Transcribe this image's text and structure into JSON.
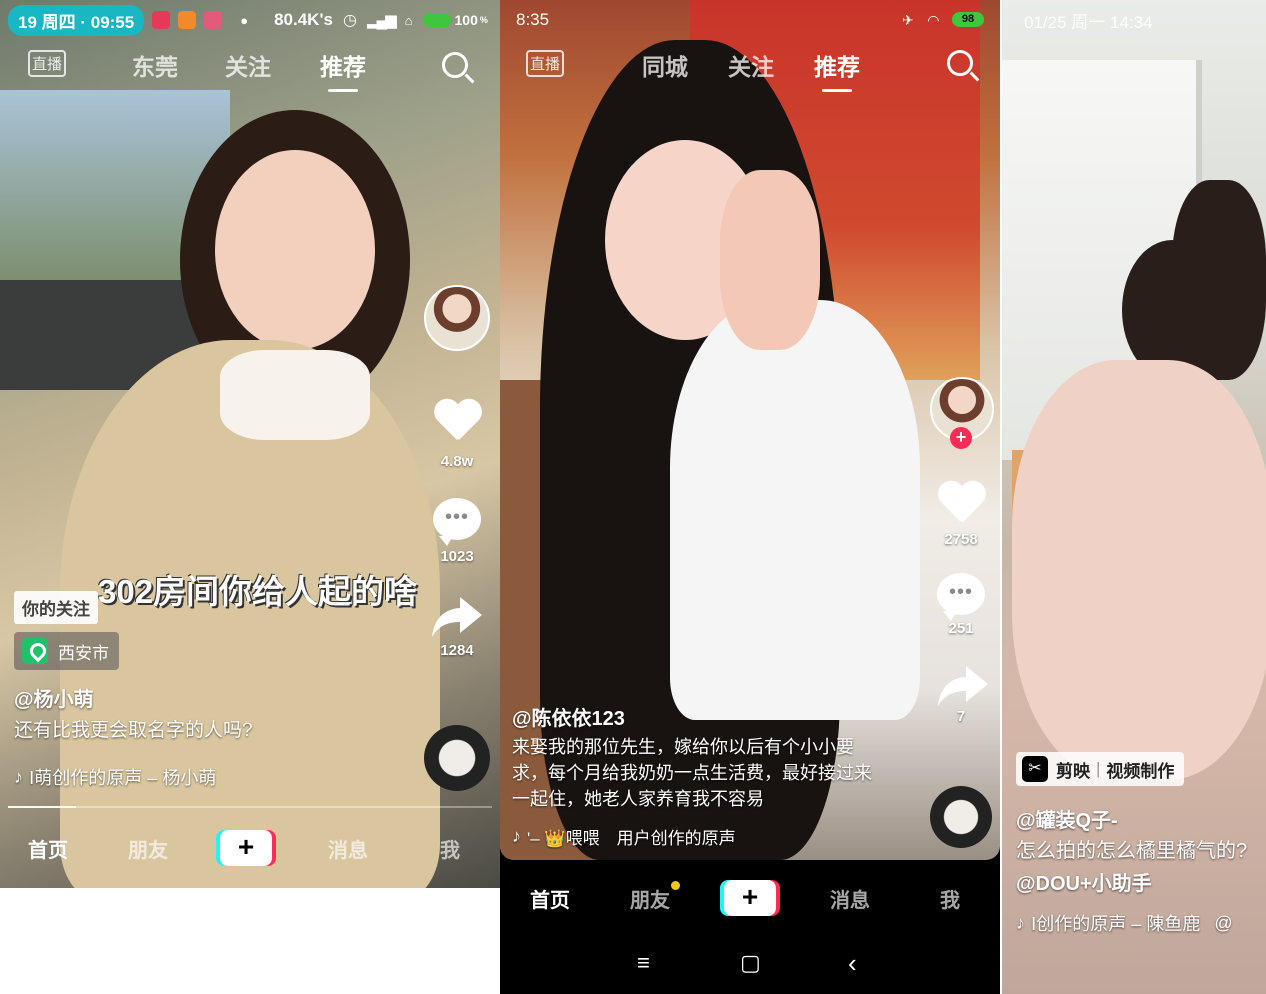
{
  "panel1": {
    "status": {
      "time": "19 周四 · 09:55",
      "net_speed": "80.4K's",
      "battery": "100",
      "battery_unit": "%"
    },
    "tabs": {
      "live": "直播",
      "items": [
        "东莞",
        "关注",
        "推荐"
      ],
      "active": "推荐"
    },
    "rail": {
      "likes": "4.8w",
      "comments": "1023",
      "shares": "1284"
    },
    "overlay_text": "302房间你给人起的啥",
    "tag": "你的关注",
    "location": "西安市",
    "author": "@杨小萌",
    "description": "还有比我更会取名字的人吗?",
    "music": "Ⅰ萌创作的原声 – 杨小萌",
    "progress": 0.14,
    "nav": {
      "home": "首页",
      "friends": "朋友",
      "plus": "+",
      "messages": "消息",
      "me": "我"
    },
    "icons": [
      "search-icon",
      "heart-icon",
      "comment-icon",
      "share-icon",
      "music-note-icon",
      "location-icon"
    ]
  },
  "panel2": {
    "status": {
      "time": "8:35",
      "battery": "98"
    },
    "tabs": {
      "live": "直播",
      "items": [
        "同城",
        "关注",
        "推荐"
      ],
      "active": "推荐"
    },
    "rail": {
      "likes": "2758",
      "comments": "251",
      "shares": "7",
      "follow": "+"
    },
    "author": "@陈依依123",
    "description": "来娶我的那位先生，嫁给你以后有个小小要求，每个月给我奶奶一点生活费，最好接过来一起住，她老人家养育我不容易",
    "music": "'– 👑喂喂　用户创作的原声",
    "nav": {
      "home": "首页",
      "friends": "朋友",
      "plus": "+",
      "messages": "消息",
      "me": "我"
    },
    "sysnav": {
      "menu": "≡",
      "home": "▢",
      "back": "‹"
    }
  },
  "panel3": {
    "status": {
      "time": "01/25 周一 14:34"
    },
    "capcut": {
      "brand": "剪映",
      "label": "视频制作"
    },
    "author": "@罐装Q子-",
    "description": "怎么拍的怎么橘里橘气的?",
    "mention": "@DOU+小助手",
    "music": "Ⅰ创作的原声 – 陳鱼鹿",
    "music_tail": "@"
  },
  "colors": {
    "accent_red": "#fe2c55",
    "accent_cyan": "#25f4ee",
    "status_pill": "#19b6c4",
    "battery_green": "#3ec63e"
  }
}
